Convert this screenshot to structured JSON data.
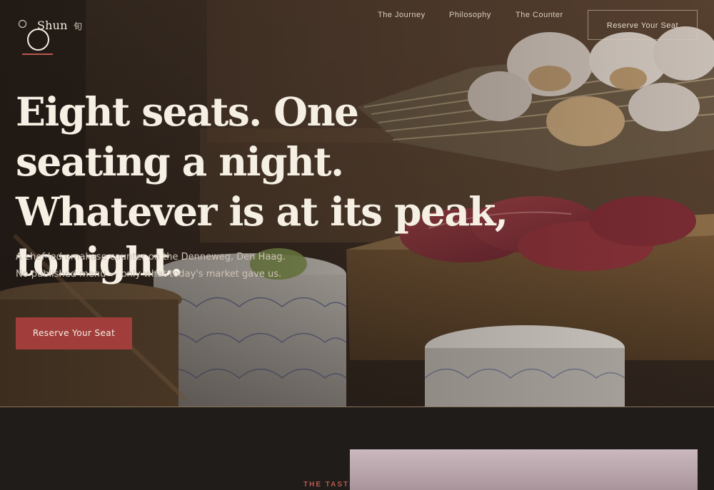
{
  "brand": {
    "name": "Shun",
    "kanji": "旬"
  },
  "nav": {
    "links": [
      {
        "label": "The Journey"
      },
      {
        "label": "Philosophy"
      },
      {
        "label": "The Counter"
      }
    ],
    "cta_label": "Reserve Your Seat"
  },
  "hero": {
    "headline": "Eight seats. One seating a night. Whatever is at its peak, tonight.",
    "subcopy": "A chef-led omakase counter on the Denneweg, Den Haag. No published menu — only what today's market gave us.",
    "cta_label": "Reserve Your Seat"
  },
  "section": {
    "eyebrow": "THE TASTI"
  },
  "colors": {
    "accent": "#a13e3b",
    "underline": "#b8584e",
    "background": "#1f1c1a",
    "headline": "#f5efe4"
  }
}
